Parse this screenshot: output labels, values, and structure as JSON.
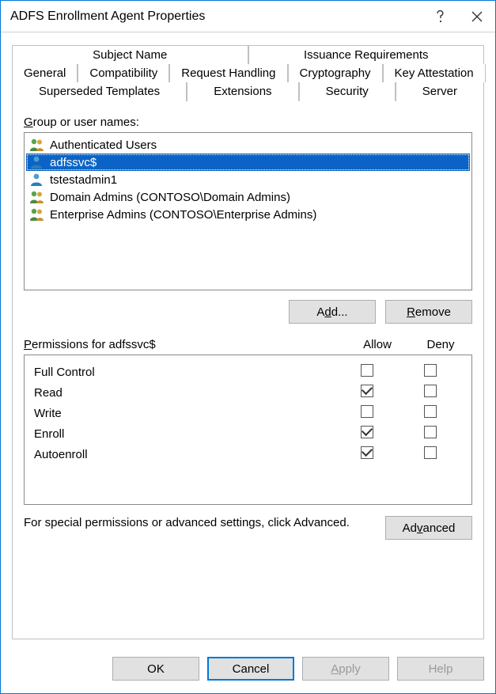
{
  "window": {
    "title": "ADFS Enrollment Agent Properties"
  },
  "tabs": {
    "row1": [
      {
        "label": "Subject Name"
      },
      {
        "label": "Issuance Requirements"
      }
    ],
    "row2": [
      {
        "label": "General"
      },
      {
        "label": "Compatibility"
      },
      {
        "label": "Request Handling"
      },
      {
        "label": "Cryptography"
      },
      {
        "label": "Key Attestation"
      }
    ],
    "row3": [
      {
        "label": "Superseded Templates"
      },
      {
        "label": "Extensions"
      },
      {
        "label": "Security",
        "active": true
      },
      {
        "label": "Server"
      }
    ]
  },
  "security": {
    "groupLabelPrefix": "G",
    "groupLabelRest": "roup or user names:",
    "users": [
      {
        "name": "Authenticated Users",
        "icon": "users",
        "selected": false
      },
      {
        "name": "adfssvc$",
        "icon": "user",
        "selected": true
      },
      {
        "name": "tstestadmin1",
        "icon": "user",
        "selected": false
      },
      {
        "name": "Domain Admins (CONTOSO\\Domain Admins)",
        "icon": "users",
        "selected": false
      },
      {
        "name": "Enterprise Admins (CONTOSO\\Enterprise Admins)",
        "icon": "users",
        "selected": false
      }
    ],
    "addLabelPrefix": "A",
    "addLabelKey": "d",
    "addLabelRest": "d...",
    "removeLabelKey": "R",
    "removeLabelRest": "emove",
    "permLabelKey": "P",
    "permLabelRest": "ermissions for adfssvc$",
    "allowLabel": "Allow",
    "denyLabel": "Deny",
    "permissions": [
      {
        "name": "Full Control",
        "allow": false,
        "deny": false
      },
      {
        "name": "Read",
        "allow": true,
        "deny": false
      },
      {
        "name": "Write",
        "allow": false,
        "deny": false
      },
      {
        "name": "Enroll",
        "allow": true,
        "deny": false
      },
      {
        "name": "Autoenroll",
        "allow": true,
        "deny": false
      }
    ],
    "advancedText": "For special permissions or advanced settings, click Advanced.",
    "advancedBtnPrefix": "Ad",
    "advancedBtnKey": "v",
    "advancedBtnRest": "anced"
  },
  "buttons": {
    "ok": "OK",
    "cancel": "Cancel",
    "applyKey": "A",
    "applyRest": "pply",
    "help": "Help"
  }
}
